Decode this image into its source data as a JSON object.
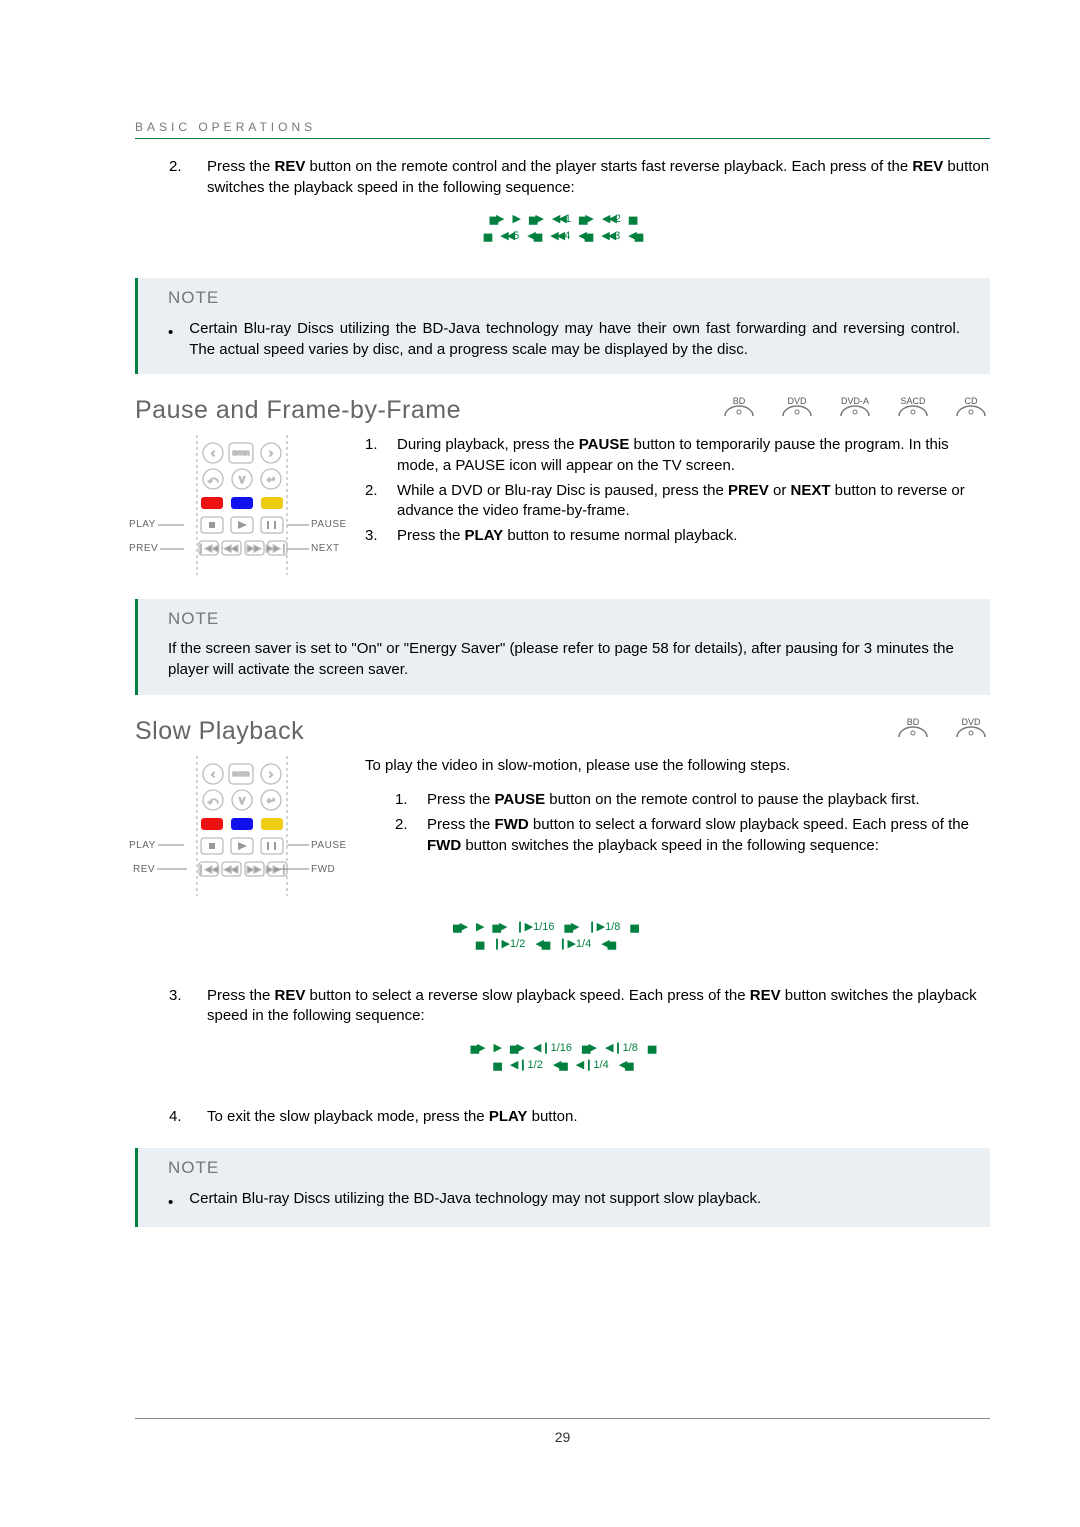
{
  "header": "BASIC OPERATIONS",
  "page_number": "29",
  "para1_item_num": "2.",
  "para1_text_a": "Press the ",
  "para1_b1": "REV",
  "para1_text_b": " button on the remote control and the player starts fast reverse playback.  Each press of the ",
  "para1_b2": "REV",
  "para1_text_c": " button switches the playback speed in the following sequence:",
  "speed1": {
    "top": [
      "▶",
      "◀◀1",
      "◀◀2"
    ],
    "bot": [
      "◀◀5",
      "◀◀ 4",
      "◀◀3"
    ]
  },
  "note1_head": "NOTE",
  "note1_text": "Certain Blu-ray Discs utilizing the BD-Java technology may have their own fast forwarding and reversing control.  The actual speed varies by disc, and a progress scale may be displayed by the disc.",
  "sec1_title": "Pause and Frame-by-Frame",
  "discs_all": [
    "BD",
    "DVD",
    "DVD-A",
    "SACD",
    "CD"
  ],
  "remote1_labels": {
    "play": "PLAY",
    "prev": "PREV",
    "pause": "PAUSE",
    "next": "NEXT"
  },
  "sec1_items": [
    {
      "n": "1.",
      "t_a": "During playback, press the ",
      "b": "PAUSE",
      "t_b": " button to temporarily pause the program. In this mode, a PAUSE icon will appear on the TV screen."
    },
    {
      "n": "2.",
      "t_a": "While a DVD or Blu-ray Disc is paused, press the ",
      "b": "PREV",
      "t_b": " or ",
      "b2": "NEXT",
      "t_c": " button to reverse or advance the video frame-by-frame."
    },
    {
      "n": "3.",
      "t_a": "Press the ",
      "b": "PLAY",
      "t_b": " button to resume normal playback."
    }
  ],
  "note2_head": "NOTE",
  "note2_text": "If the screen saver is set to \"On\" or \"Energy Saver\" (please refer to page 58 for details), after pausing for 3 minutes the player will activate the screen saver.",
  "sec2_title": "Slow Playback",
  "discs_sm": [
    "BD",
    "DVD"
  ],
  "remote2_labels": {
    "play": "PLAY",
    "rev": "REV",
    "pause": "PAUSE",
    "fwd": "FWD"
  },
  "sec2_intro": "To play the video in slow-motion, please use the following steps.",
  "sec2_items": [
    {
      "n": "1.",
      "t_a": "Press the ",
      "b": "PAUSE",
      "t_b": " button on the remote control to pause the playback first."
    },
    {
      "n": "2.",
      "t_a": "Press the ",
      "b": "FWD",
      "t_b": " button to select a forward slow playback speed. Each press of the ",
      "b2": "FWD",
      "t_c": " button switches the playback speed in the following sequence:"
    }
  ],
  "speed2": {
    "top": [
      "▶",
      "❙▶1/16",
      "❙▶1/8"
    ],
    "bot": [
      "❙▶1/2",
      "❙▶1/4"
    ]
  },
  "sec2_item3_n": "3.",
  "sec2_item3_a": "Press the ",
  "sec2_item3_b1": "REV",
  "sec2_item3_mid": " button to select a reverse slow playback speed.  Each press of the ",
  "sec2_item3_b2": "REV",
  "sec2_item3_end": " button switches the playback speed in the following sequence:",
  "speed3": {
    "top": [
      "▶",
      "◀❙1/16",
      "◀❙1/8"
    ],
    "bot": [
      "◀❙1/2",
      "◀❙1/4"
    ]
  },
  "sec2_item4_n": "4.",
  "sec2_item4_a": "To exit the slow playback mode, press the ",
  "sec2_item4_b": "PLAY",
  "sec2_item4_c": " button.",
  "note3_head": "NOTE",
  "note3_text": "Certain Blu-ray Discs utilizing the BD-Java technology may not support slow playback."
}
